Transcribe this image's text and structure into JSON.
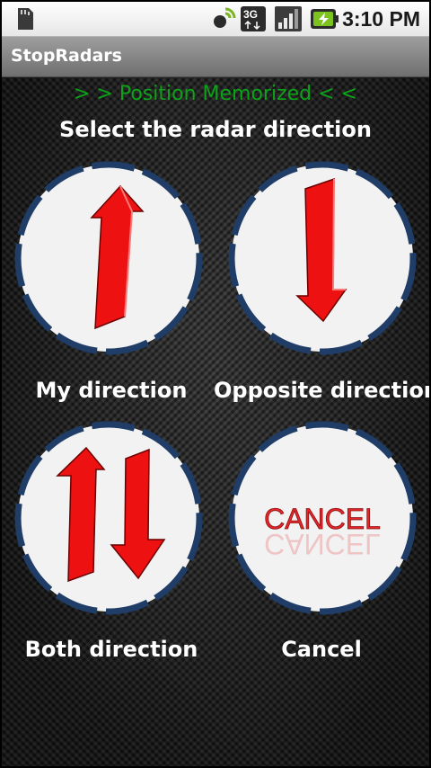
{
  "status_bar": {
    "time": "3:10 PM",
    "network": "3G",
    "icons": [
      "sd-card-icon",
      "gps-satellite-icon",
      "network-3g-icon",
      "signal-bars-icon",
      "battery-charging-icon"
    ]
  },
  "app": {
    "title": "StopRadars"
  },
  "main": {
    "status_message": "> > Position Memorized < <",
    "prompt": "Select the radar direction",
    "buttons": [
      {
        "label": "My direction",
        "icon": "arrow-up-icon"
      },
      {
        "label": "Opposite direction",
        "icon": "arrow-down-icon"
      },
      {
        "label": "Both direction",
        "icon": "arrows-up-down-icon"
      },
      {
        "label": "Cancel",
        "icon": "cancel-icon",
        "icon_text": "CANCEL"
      }
    ]
  },
  "colors": {
    "status_message": "#0ca318",
    "arrow_red": "#ee1111",
    "circle_border": "#1f3d66",
    "circle_fill": "#f2f2f2"
  }
}
